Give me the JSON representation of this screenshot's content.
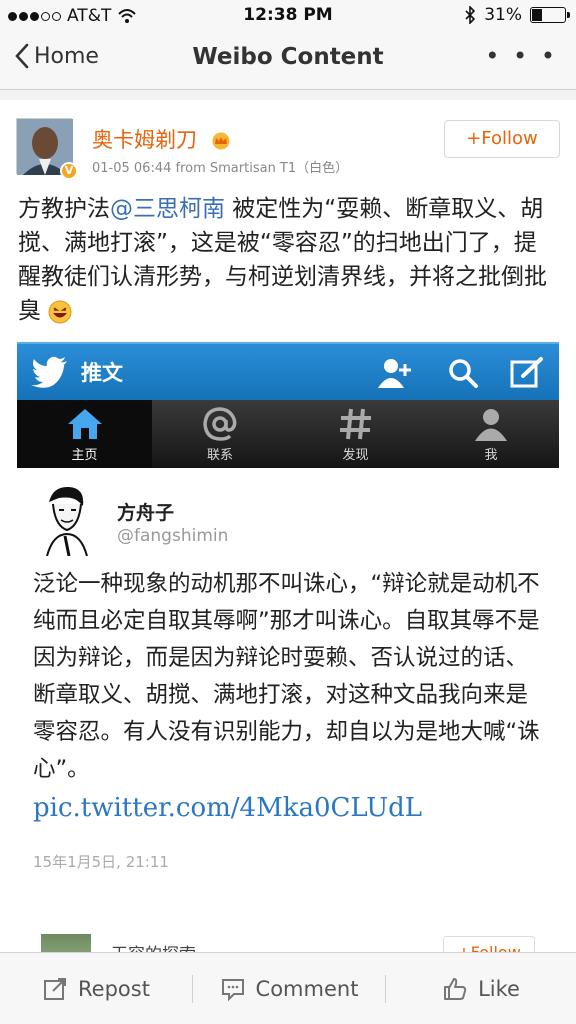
{
  "status_bar": {
    "carrier": "AT&T",
    "time": "12:38 PM",
    "battery_percent": "31%",
    "battery_level": 0.31,
    "signal_bars_filled": 3,
    "signal_bars_total": 5
  },
  "nav": {
    "back_label": "Home",
    "title": "Weibo Content",
    "more_label": "• • •"
  },
  "post": {
    "username": "奥卡姆剃刀",
    "verified_badge": "V",
    "meta": "01-05 06:44  from Smartisan T1（白色）",
    "follow_label": "+Follow",
    "text_before": "方教护法",
    "mention": "@三思柯南",
    "text_after": " 被定性为“耍赖、断章取义、胡搅、满地打滚”，这是被“零容忍”的扫地出门了，提醒教徒们认清形势，与柯逆划清界线，并将之批倒批臭"
  },
  "embedded_tweet": {
    "header_title": "推文",
    "tabs": [
      {
        "label": "主页",
        "icon": "home-icon",
        "active": true
      },
      {
        "label": "联系",
        "icon": "at-icon",
        "active": false
      },
      {
        "label": "发现",
        "icon": "hashtag-icon",
        "active": false
      },
      {
        "label": "我",
        "icon": "person-icon",
        "active": false
      }
    ],
    "author_name": "方舟子",
    "author_handle": "@fangshimin",
    "text": "泛论一种现象的动机那不叫诛心，“辩论就是动机不纯而且必定自取其辱啊”那才叫诛心。自取其辱不是因为辩论，而是因为辩论时耍赖、否认说过的话、断章取义、胡搅、满地打滚，对这种文品我向来是零容忍。有人没有识别能力，却自以为是地大喊“诛心”。",
    "link": "pic.twitter.com/4Mka0CLUdL",
    "timestamp": "15年1月5日, 21:11",
    "next_user_name": "天容的探索",
    "next_follow_label": "+Follow"
  },
  "bottom_bar": {
    "repost": "Repost",
    "comment": "Comment",
    "like": "Like"
  },
  "colors": {
    "accent_orange": "#e8640c",
    "link_blue": "#3a6fb4",
    "twitter_blue": "#1672b9"
  }
}
